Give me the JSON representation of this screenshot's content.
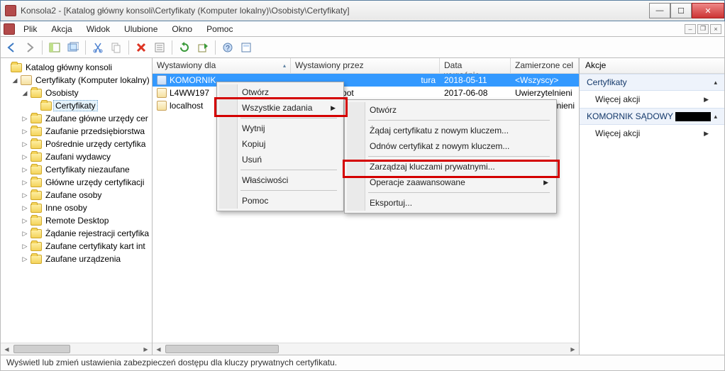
{
  "window": {
    "title": "Konsola2 - [Katalog główny konsoli\\Certyfikaty (Komputer lokalny)\\Osobisty\\Certyfikaty]"
  },
  "menu": {
    "items": [
      "Plik",
      "Akcja",
      "Widok",
      "Ulubione",
      "Okno",
      "Pomoc"
    ]
  },
  "tree": {
    "root": "Katalog główny konsoli",
    "certs": "Certyfikaty (Komputer lokalny)",
    "nodes": [
      {
        "label": "Osobisty",
        "expanded": true
      },
      {
        "label": "Certyfikaty",
        "selected": true,
        "child": true
      },
      {
        "label": "Zaufane główne urzędy cer"
      },
      {
        "label": "Zaufanie przedsiębiorstwa"
      },
      {
        "label": "Pośrednie urzędy certyfika"
      },
      {
        "label": "Zaufani wydawcy"
      },
      {
        "label": "Certyfikaty niezaufane"
      },
      {
        "label": "Główne urzędy certyfikacji"
      },
      {
        "label": "Zaufane osoby"
      },
      {
        "label": "Inne osoby"
      },
      {
        "label": "Remote Desktop"
      },
      {
        "label": "Żądanie rejestracji certyfika"
      },
      {
        "label": "Zaufane certyfikaty kart int"
      },
      {
        "label": "Zaufane urządzenia"
      }
    ]
  },
  "list": {
    "columns": {
      "issued_for": "Wystawiony dla",
      "issued_by": "Wystawiony przez",
      "expires": "Data wygaśnie...",
      "purpose": "Zamierzone cel"
    },
    "rows": [
      {
        "name": "KOMORNIK",
        "name_tail": "tura",
        "by": "",
        "date": "2018-05-11",
        "purpose": "<Wszyscy>",
        "selected": true
      },
      {
        "name": "L4WW197",
        "by": "Currenda.sopot",
        "date": "2017-06-08",
        "purpose": "Uwierzytelnieni"
      },
      {
        "name": "localhost",
        "by": "",
        "date": "",
        "purpose": "ytelnieni"
      }
    ]
  },
  "actions": {
    "title": "Akcje",
    "sections": [
      {
        "head": "Certyfikaty",
        "items": [
          "Więcej akcji"
        ]
      },
      {
        "head": "KOMORNIK SĄDOWY",
        "items": [
          "Więcej akcji"
        ],
        "black": true
      }
    ]
  },
  "context1": {
    "items": [
      {
        "label": "Otwórz"
      },
      {
        "label": "Wszystkie zadania",
        "sub": true,
        "hl": true
      },
      {
        "sep": true
      },
      {
        "label": "Wytnij"
      },
      {
        "label": "Kopiuj"
      },
      {
        "label": "Usuń"
      },
      {
        "sep": true
      },
      {
        "label": "Właściwości"
      },
      {
        "sep": true
      },
      {
        "label": "Pomoc"
      }
    ]
  },
  "context2": {
    "items": [
      {
        "label": "Otwórz"
      },
      {
        "sep": true
      },
      {
        "label": "Żądaj certyfikatu z nowym kluczem..."
      },
      {
        "label": "Odnów certyfikat z nowym kluczem..."
      },
      {
        "sep": true
      },
      {
        "label": "Zarządzaj kluczami prywatnymi...",
        "hl": true
      },
      {
        "label": "Operacje zaawansowane",
        "sub": true
      },
      {
        "sep": true
      },
      {
        "label": "Eksportuj..."
      }
    ]
  },
  "status": "Wyświetl lub zmień ustawienia zabezpieczeń dostępu dla kluczy prywatnych certyfikatu."
}
